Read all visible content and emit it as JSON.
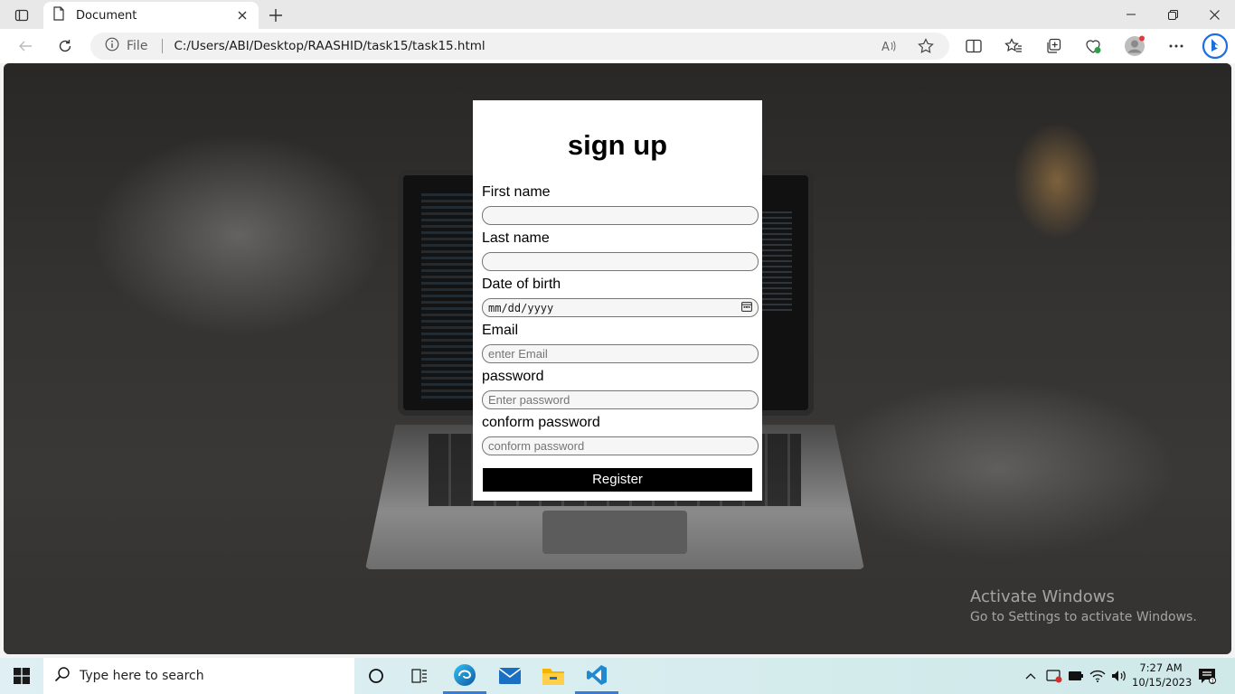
{
  "browser": {
    "tab_title": "Document",
    "address": {
      "scheme_label": "File",
      "url": "C:/Users/ABI/Desktop/RAASHID/task15/task15.html"
    }
  },
  "form": {
    "heading": "sign up",
    "fields": [
      {
        "label": "First name",
        "value": "",
        "placeholder": ""
      },
      {
        "label": "Last name",
        "value": "",
        "placeholder": ""
      },
      {
        "label": "Date of birth",
        "value": "mm/dd/yyyy",
        "placeholder": ""
      },
      {
        "label": "Email",
        "value": "",
        "placeholder": "enter Email"
      },
      {
        "label": "password",
        "value": "",
        "placeholder": "Enter password"
      },
      {
        "label": "conform password",
        "value": "",
        "placeholder": "conform password"
      }
    ],
    "submit_label": "Register"
  },
  "watermark": {
    "line1": "Activate Windows",
    "line2": "Go to Settings to activate Windows."
  },
  "taskbar": {
    "search_placeholder": "Type here to search",
    "time": "7:27 AM",
    "date": "10/15/2023",
    "apps": [
      "task-view-icon",
      "widgets-icon",
      "edge-icon",
      "mail-icon",
      "file-explorer-icon",
      "vscode-icon"
    ]
  },
  "colors": {
    "accent": "#3a7bd5",
    "button_bg": "#000000",
    "card_bg": "#ffffff"
  }
}
